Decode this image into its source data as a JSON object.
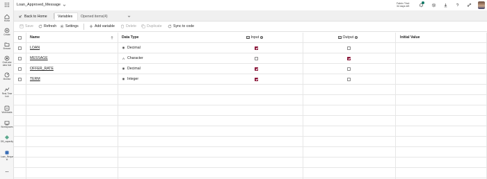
{
  "rail": {
    "items": [
      {
        "label": "Home",
        "icon": "home-icon"
      },
      {
        "label": "Create",
        "icon": "plus-circle-icon"
      },
      {
        "label": "Browse",
        "icon": "folder-icon"
      },
      {
        "label": "OneLake data hub",
        "icon": "onelake-icon"
      },
      {
        "label": "Monitor",
        "icon": "monitor-icon"
      },
      {
        "label": "Real-Time hub",
        "icon": "realtime-icon"
      },
      {
        "label": "Workloads",
        "icon": "workloads-icon"
      },
      {
        "label": "Workspaces",
        "icon": "workspaces-icon"
      },
      {
        "label": "DB_capacity",
        "icon": "workspace-item-icon"
      },
      {
        "label": "Loan_Reque st",
        "icon": "item-icon"
      },
      {
        "label": "...",
        "icon": "more-icon"
      }
    ]
  },
  "topbar": {
    "app_title": "Loan_Approved_Message",
    "trial_line1": "Fabric Trial:",
    "trial_line2": "34 days left",
    "notifications_count": "2"
  },
  "tabs": {
    "back_label": "Back to Home",
    "variables_label": "Variables",
    "opened_items_label": "Opened items(4)"
  },
  "toolbar": {
    "save": "Save",
    "refresh": "Refresh",
    "settings": "Settings",
    "add_variable": "Add variable",
    "delete": "Delete",
    "duplicate": "Duplicate",
    "sync": "Sync to code"
  },
  "table": {
    "columns": {
      "name": "Name",
      "type": "Data Type",
      "input": "Input",
      "output": "Output",
      "initial": "Initial Value"
    },
    "rows": [
      {
        "name": "LOAN",
        "type": "Decimal",
        "type_icon": "decimal-icon",
        "input": true,
        "output": false
      },
      {
        "name": "MESSAGE",
        "type": "Character",
        "type_icon": "character-icon",
        "input": false,
        "output": true
      },
      {
        "name": "OFFER_RATE",
        "type": "Decimal",
        "type_icon": "decimal-icon",
        "input": true,
        "output": false
      },
      {
        "name": "TERM",
        "type": "Integer",
        "type_icon": "integer-icon",
        "input": true,
        "output": false
      }
    ]
  },
  "colors": {
    "accent": "#8a1538",
    "brand": "#117865"
  }
}
